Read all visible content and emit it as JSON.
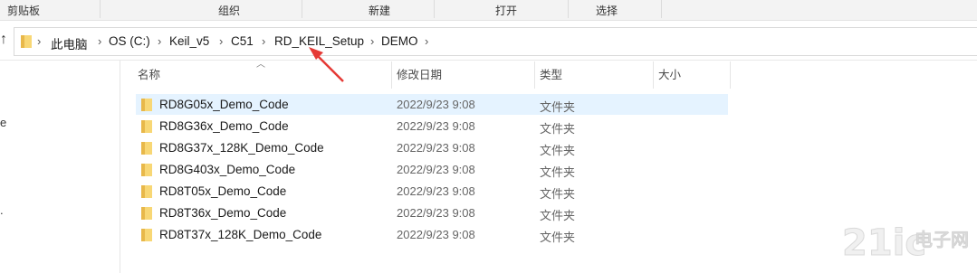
{
  "ribbon": {
    "groups": [
      "剪贴板",
      "组织",
      "新建",
      "打开",
      "选择"
    ]
  },
  "address": {
    "crumbs": [
      "此电脑",
      "OS (C:)",
      "Keil_v5",
      "C51",
      "RD_KEIL_Setup",
      "DEMO"
    ]
  },
  "nav_pane": {
    "fragments": [
      "e",
      "."
    ]
  },
  "columns": {
    "name": "名称",
    "date": "修改日期",
    "type": "类型",
    "size": "大小"
  },
  "files": [
    {
      "name": "RD8G05x_Demo_Code",
      "date": "2022/9/23 9:08",
      "type": "文件夹",
      "selected": true
    },
    {
      "name": "RD8G36x_Demo_Code",
      "date": "2022/9/23 9:08",
      "type": "文件夹",
      "selected": false
    },
    {
      "name": "RD8G37x_128K_Demo_Code",
      "date": "2022/9/23 9:08",
      "type": "文件夹",
      "selected": false
    },
    {
      "name": "RD8G403x_Demo_Code",
      "date": "2022/9/23 9:08",
      "type": "文件夹",
      "selected": false
    },
    {
      "name": "RD8T05x_Demo_Code",
      "date": "2022/9/23 9:08",
      "type": "文件夹",
      "selected": false
    },
    {
      "name": "RD8T36x_Demo_Code",
      "date": "2022/9/23 9:08",
      "type": "文件夹",
      "selected": false
    },
    {
      "name": "RD8T37x_128K_Demo_Code",
      "date": "2022/9/23 9:08",
      "type": "文件夹",
      "selected": false
    }
  ],
  "watermark": {
    "text": "21ic电子网"
  },
  "colors": {
    "selection": "#e5f3ff",
    "folder": "#f8d775",
    "folder_dark": "#e8b84a",
    "annotation": "#e53935"
  }
}
